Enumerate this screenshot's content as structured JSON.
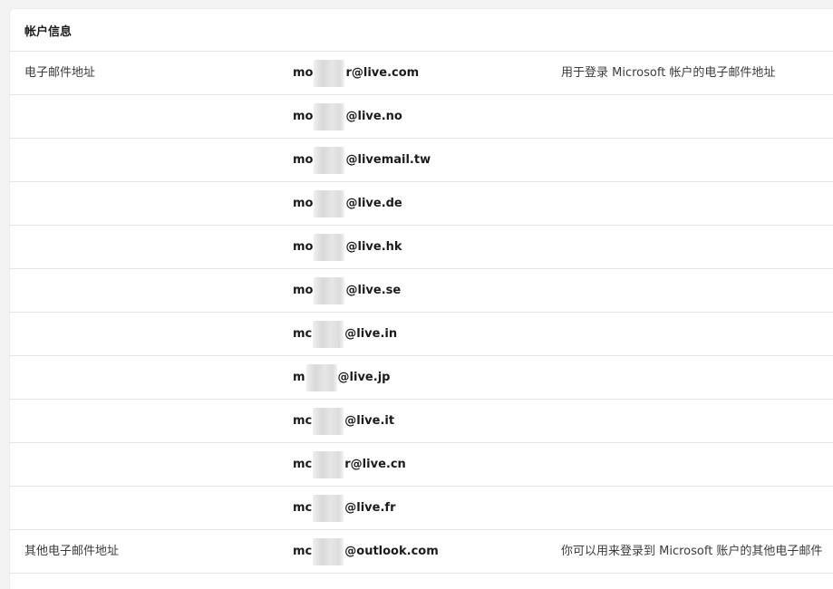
{
  "section": {
    "title": "帐户信息"
  },
  "rows": [
    {
      "label": "电子邮件地址",
      "email_prefix": "mo",
      "email_domain": "r@live.com",
      "description": "用于登录 Microsoft 帐户的电子邮件地址"
    },
    {
      "label": "",
      "email_prefix": "mo",
      "email_domain": "@live.no",
      "description": ""
    },
    {
      "label": "",
      "email_prefix": "mo",
      "email_domain": "@livemail.tw",
      "description": ""
    },
    {
      "label": "",
      "email_prefix": "mo",
      "email_domain": "@live.de",
      "description": ""
    },
    {
      "label": "",
      "email_prefix": "mo",
      "email_domain": "@live.hk",
      "description": ""
    },
    {
      "label": "",
      "email_prefix": "mo",
      "email_domain": "@live.se",
      "description": ""
    },
    {
      "label": "",
      "email_prefix": "mc",
      "email_domain": "@live.in",
      "description": ""
    },
    {
      "label": "",
      "email_prefix": "m",
      "email_domain": "@live.jp",
      "description": ""
    },
    {
      "label": "",
      "email_prefix": "mc",
      "email_domain": "@live.it",
      "description": ""
    },
    {
      "label": "",
      "email_prefix": "mc",
      "email_domain": "r@live.cn",
      "description": ""
    },
    {
      "label": "",
      "email_prefix": "mc",
      "email_domain": "@live.fr",
      "description": ""
    },
    {
      "label": "其他电子邮件地址",
      "email_prefix": "mc",
      "email_domain": "@outlook.com",
      "description": "你可以用来登录到 Microsoft 账户的其他电子邮件"
    }
  ]
}
